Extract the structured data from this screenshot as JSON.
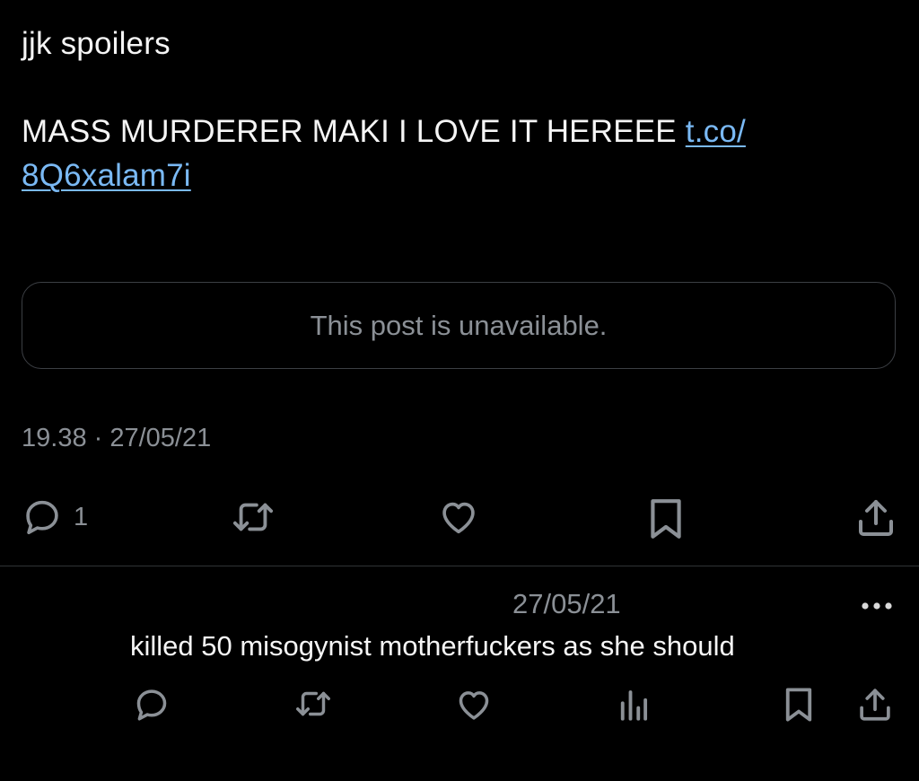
{
  "post": {
    "text_line1": "jjk spoilers",
    "text_line3": "MASS MURDERER MAKI I LOVE IT HEREEE ",
    "link_part1": "t.co/",
    "link_part2": "8Q6xalam7i",
    "quote_unavailable": "This post is unavailable.",
    "timestamp": "19.38 · 27/05/21",
    "actions": {
      "reply_count": "1",
      "icons": [
        "reply-icon",
        "retweet-icon",
        "like-icon",
        "bookmark-icon",
        "share-icon"
      ]
    }
  },
  "reply": {
    "date": "27/05/21",
    "text": "killed 50 misogynist motherfuckers as she should",
    "icons": [
      "reply-icon",
      "retweet-icon",
      "like-icon",
      "views-icon",
      "bookmark-icon",
      "share-icon"
    ]
  },
  "colors": {
    "background": "#000000",
    "text": "#f5f5f5",
    "secondary": "#8b9096",
    "link": "#7ab9f4",
    "border": "#3c3f44"
  }
}
